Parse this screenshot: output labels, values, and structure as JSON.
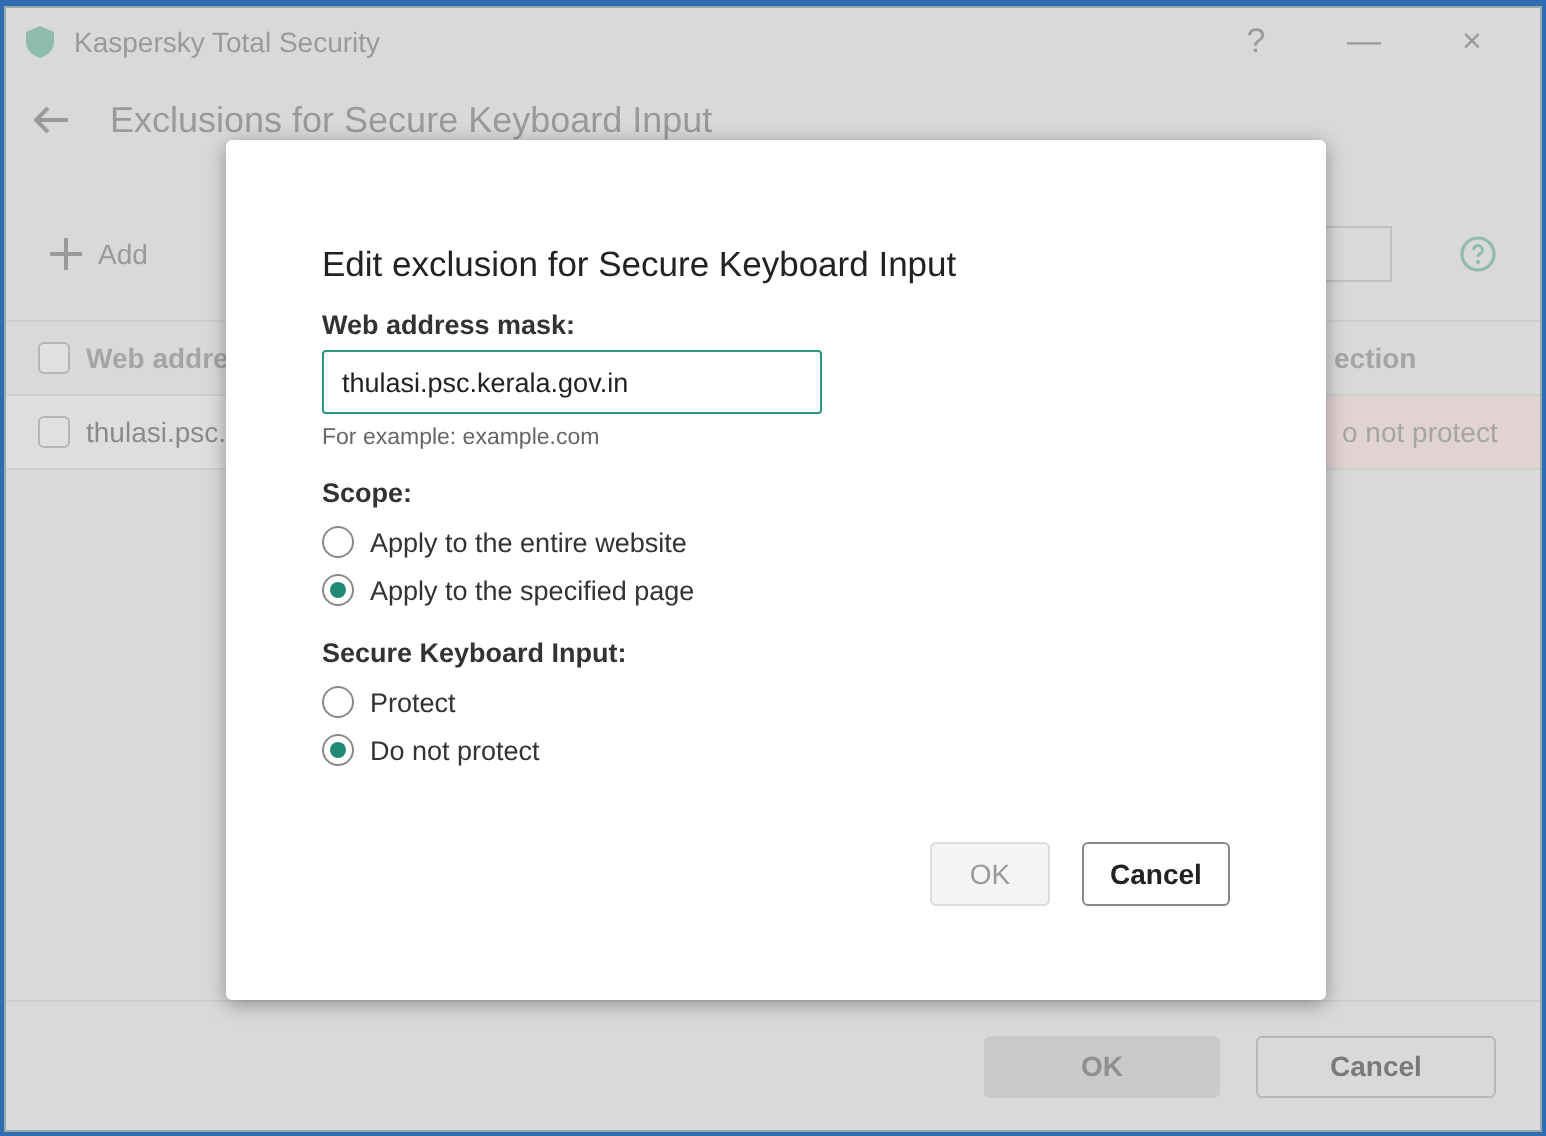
{
  "window": {
    "title": "Kaspersky Total Security",
    "controls": [
      "?",
      "—",
      "×"
    ]
  },
  "page": {
    "title": "Exclusions for Secure Keyboard Input",
    "add": "Add"
  },
  "table": {
    "header_checked": false,
    "columns": [
      "Web addre",
      "ection"
    ],
    "rows": [
      {
        "checked": false,
        "cells": [
          "thulasi.psc.",
          "o not protect"
        ]
      }
    ]
  },
  "footer": {
    "buttons": [
      {
        "label": "OK",
        "disabled": true
      },
      {
        "label": "Cancel",
        "disabled": false
      }
    ]
  },
  "dialog": {
    "title": "Edit exclusion for Secure Keyboard Input",
    "mask_label": "Web address mask:",
    "mask_value": "thulasi.psc.kerala.gov.in",
    "mask_hint": "For example: example.com",
    "groups": [
      {
        "label": "Scope:",
        "options": [
          {
            "label": "Apply to the entire website",
            "selected": false
          },
          {
            "label": "Apply to the specified page",
            "selected": true
          }
        ]
      },
      {
        "label": "Secure Keyboard Input:",
        "options": [
          {
            "label": "Protect",
            "selected": false
          },
          {
            "label": "Do not protect",
            "selected": true
          }
        ]
      }
    ],
    "buttons": [
      {
        "label": "OK",
        "disabled": true
      },
      {
        "label": "Cancel",
        "disabled": false
      }
    ]
  }
}
